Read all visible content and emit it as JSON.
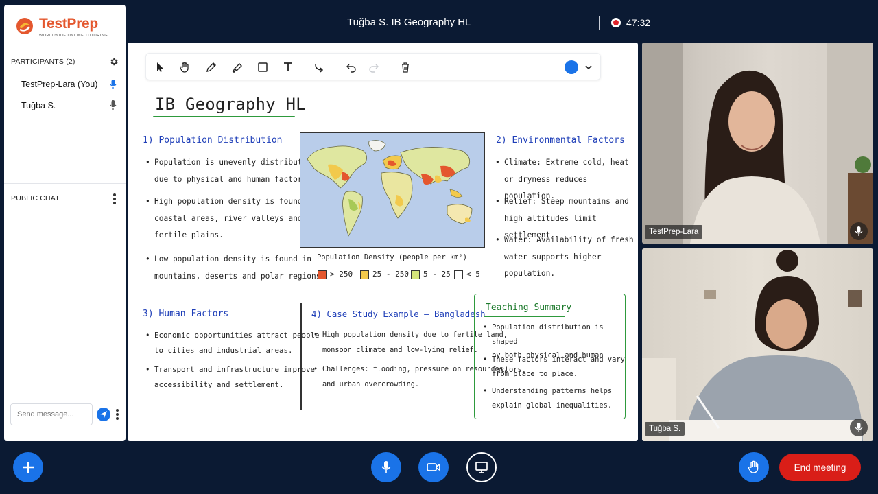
{
  "header": {
    "meeting_title": "Tuğba S. IB Geography HL",
    "recording_time": "47:32"
  },
  "brand": {
    "name": "TestPrep",
    "tagline": "WORLDWIDE ONLINE TUTORING",
    "accent_color": "#e4572e"
  },
  "participants": {
    "heading": "PARTICIPANTS (2)",
    "items": [
      {
        "name": "TestPrep-Lara (You)",
        "mic_color": "#1a73e8"
      },
      {
        "name": "Tuğba S.",
        "mic_color": "#555555"
      }
    ]
  },
  "chat": {
    "heading": "PUBLIC CHAT",
    "input_placeholder": "Send message..."
  },
  "whiteboard": {
    "toolbar": {
      "tools": [
        "select-icon",
        "hand-icon",
        "pencil-icon",
        "highlighter-icon",
        "rectangle-icon",
        "text-icon",
        "connector-icon",
        "undo-icon",
        "redo-icon",
        "trash-icon"
      ],
      "active_color": "#1a73e8"
    },
    "title": "IB Geography HL",
    "sections": {
      "population": {
        "title": "1) Population Distribution",
        "bullets": [
          [
            "Population is unevenly distributed",
            "due to physical and human factors."
          ],
          [
            "High population density is found in",
            "coastal areas, river valleys and",
            "fertile plains."
          ],
          [
            "Low population density is found in",
            "mountains, deserts and polar regions."
          ]
        ]
      },
      "environment": {
        "title": "2) Environmental Factors",
        "bullets": [
          [
            "Climate: Extreme cold, heat",
            "or dryness reduces population."
          ],
          [
            "Relief: Steep mountains and",
            "high altitudes limit settlement."
          ],
          [
            "Water: Availability of fresh",
            "water supports higher",
            "population."
          ]
        ]
      },
      "human": {
        "title": "3) Human Factors",
        "bullets": [
          [
            "Economic opportunities attract people",
            "to cities and industrial areas."
          ],
          [
            "Transport and infrastructure improve",
            "accessibility and settlement."
          ]
        ]
      },
      "case_study": {
        "title": "4) Case Study Example – Bangladesh",
        "bullets": [
          [
            "High population density due to fertile land,",
            "monsoon climate and low-lying relief."
          ],
          [
            "Challenges: flooding, pressure on resources,",
            "and urban overcrowding."
          ]
        ]
      },
      "summary": {
        "title": "Teaching Summary",
        "bullets": [
          [
            "Population distribution is shaped",
            "by both physical and human factors."
          ],
          [
            "These factors interact and vary",
            "from place to place."
          ],
          [
            "Understanding patterns helps",
            "explain global inequalities."
          ]
        ]
      }
    },
    "map_legend": {
      "title": "Population Density (people per km²)",
      "items": [
        {
          "label": "> 250",
          "color": "#e4572e"
        },
        {
          "label": "25 - 250",
          "color": "#f2c94c"
        },
        {
          "label": "5 - 25",
          "color": "#d4e37a"
        },
        {
          "label": "< 5",
          "color": "#ffffff"
        }
      ]
    }
  },
  "videos": [
    {
      "name": "TestPrep-Lara"
    },
    {
      "name": "Tuğba S."
    }
  ],
  "controls": {
    "end_label": "End meeting",
    "end_color": "#d91e18",
    "primary_color": "#1a73e8"
  }
}
